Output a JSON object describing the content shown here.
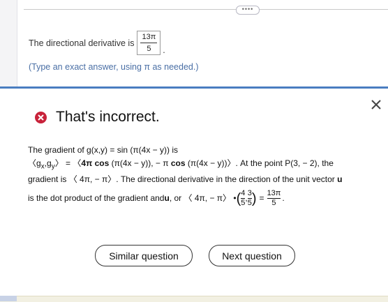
{
  "header": {
    "more_label": "••••"
  },
  "question": {
    "prompt": "The directional derivative is",
    "answer_numerator": "13π",
    "answer_denominator": "5",
    "period": ".",
    "hint": "(Type an exact answer, using π as needed.)"
  },
  "feedback": {
    "status": "That's incorrect.",
    "line1": "The gradient of g(x,y) = sin (π(4x − y)) is",
    "line2_prefix": "〈g",
    "line2_sub1": "x",
    "line2_comma": ",g",
    "line2_sub2": "y",
    "line2_mid": "〉 = 〈",
    "line2_bold1": "4π cos",
    "line2_part2": " (π(4x − y)), − π ",
    "line2_bold2": "cos",
    "line2_part3": " (π(4x − y))〉. At the point P(3, − 2), the",
    "line3_a": "gradient is 〈 4π, − π〉. The directional derivative in the direction of the unit vector ",
    "line3_u": "u",
    "line4_a": "is the dot product of the gradient and ",
    "line4_u": "u",
    "line4_b": ", or 〈 4π, − π〉 • ",
    "vec_num1": "4",
    "vec_den1": "5",
    "vec_sep": ",",
    "vec_num2": "3",
    "vec_den2": "5",
    "equals": "=",
    "result_num": "13π",
    "result_den": "5",
    "end_period": "."
  },
  "buttons": {
    "similar": "Similar question",
    "next": "Next question"
  },
  "colors": {
    "accent": "#4a7dc0",
    "error": "#c8223a",
    "hint": "#4a6fa5"
  }
}
